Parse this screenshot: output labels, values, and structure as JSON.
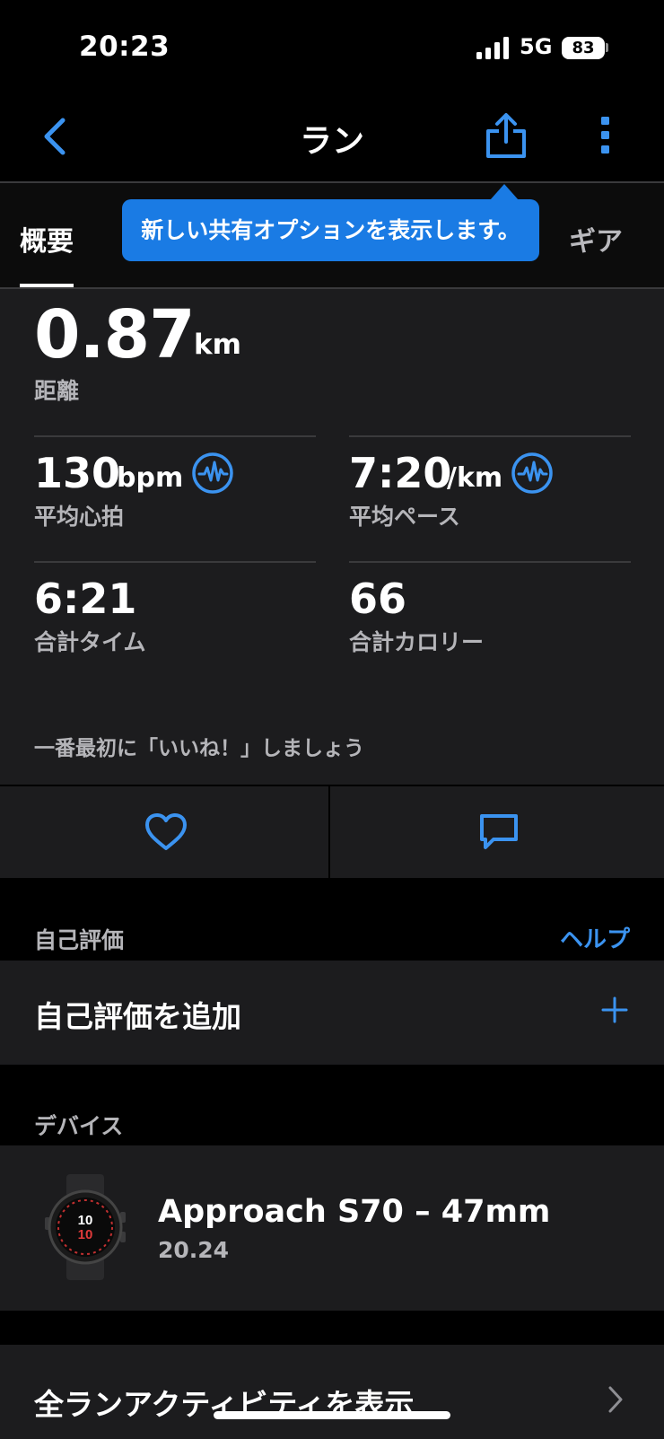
{
  "status_bar": {
    "time": "20:23",
    "network": "5G",
    "battery": "83"
  },
  "nav": {
    "title": "ラン"
  },
  "tabs": {
    "overview": "概要",
    "gear": "ギア"
  },
  "tooltip": {
    "text": "新しい共有オプションを表示します。"
  },
  "stats": {
    "distance": {
      "value": "0.87",
      "unit": "km",
      "label": "距離"
    },
    "avg_hr": {
      "value": "130",
      "unit": "bpm",
      "label": "平均心拍"
    },
    "avg_pace": {
      "value": "7:20",
      "unit": "/km",
      "label": "平均ペース"
    },
    "total_time": {
      "value": "6:21",
      "label": "合計タイム"
    },
    "total_calories": {
      "value": "66",
      "label": "合計カロリー"
    },
    "like_prompt": "一番最初に「いいね！」しましょう"
  },
  "self_evaluation": {
    "header": "自己評価",
    "help": "ヘルプ",
    "add_label": "自己評価を追加"
  },
  "devices": {
    "header": "デバイス",
    "name": "Approach S70 – 47mm",
    "version": "20.24",
    "watch_face_hour": "10",
    "watch_face_min": "10"
  },
  "all_runs": {
    "label": "全ランアクティビティを表示"
  },
  "colors": {
    "accent": "#3b93f0",
    "tooltip": "#1a7be4",
    "card": "#1c1c1e",
    "background": "#000000"
  },
  "icons": {
    "back": "chevron-left-icon",
    "share": "share-icon",
    "more": "more-vertical-icon",
    "hr_chart": "waveform-icon",
    "pace_chart": "waveform-icon",
    "like": "heart-icon",
    "comment": "comment-icon",
    "add": "plus-icon",
    "forward": "chevron-right-icon"
  }
}
